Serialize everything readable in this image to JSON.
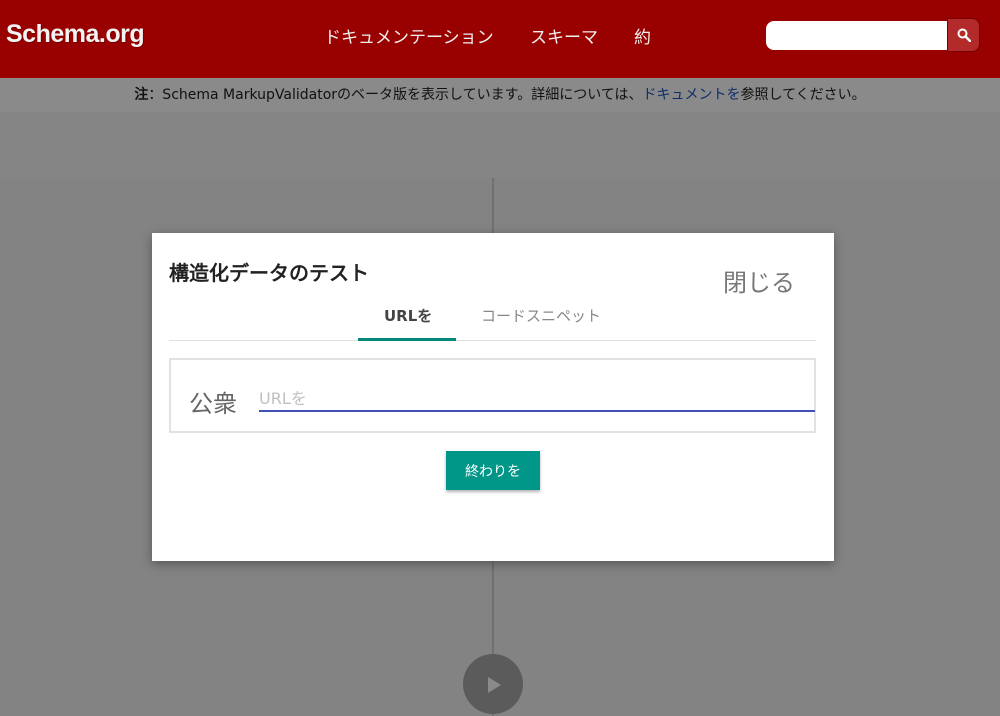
{
  "header": {
    "logo": "Schema.org",
    "nav": {
      "docs": "ドキュメンテーション",
      "schemas": "スキーマ",
      "about": "約"
    },
    "search": {
      "placeholder": "",
      "icon": "search-icon"
    },
    "brand_color": "#990000"
  },
  "notice": {
    "prefix": "注",
    "text": "：Schema MarkupValidatorのベータ版を表示しています。詳細については、",
    "link": "ドキュメントを",
    "suffix": "参照してください。"
  },
  "modal": {
    "title": "構造化データのテスト",
    "close_label": "閉じる",
    "tabs": [
      {
        "label": "URLを",
        "active": true
      },
      {
        "label": "コードスニペット",
        "active": false
      }
    ],
    "url_prefix": "公衆",
    "url_input": {
      "value": "",
      "placeholder": "URLを"
    },
    "submit_label": "終わりを",
    "accent_color": "#009688"
  },
  "run_button": {
    "icon": "play-icon"
  }
}
